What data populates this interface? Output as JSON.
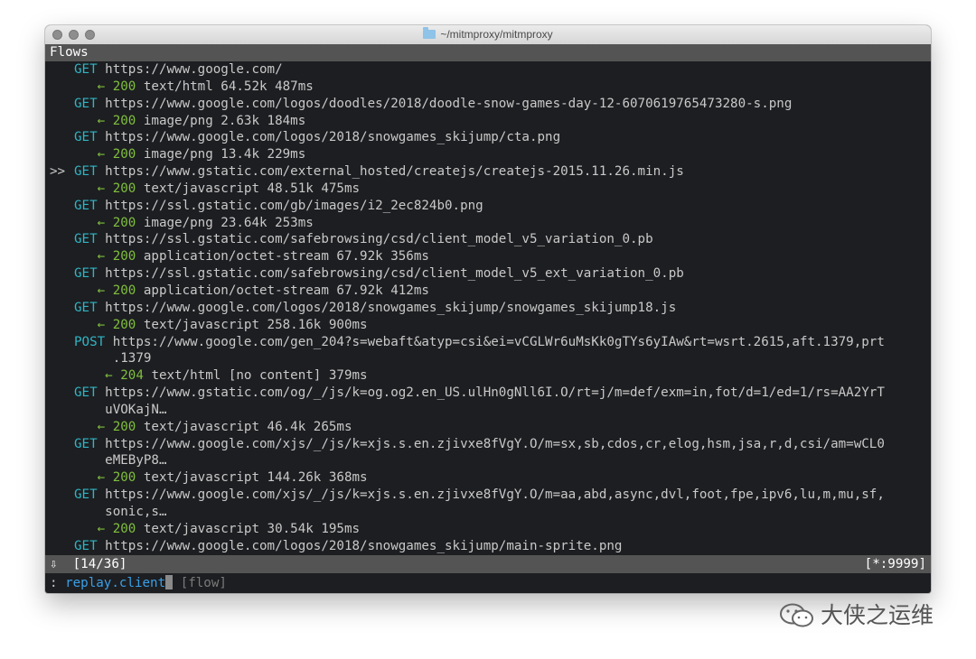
{
  "window": {
    "title": "~/mitmproxy/mitmproxy"
  },
  "header": {
    "title": "Flows"
  },
  "flows": [
    {
      "focused": false,
      "method": "GET",
      "url": "https://www.google.com/",
      "status": "200",
      "response": "text/html 64.52k 487ms"
    },
    {
      "focused": false,
      "method": "GET",
      "url": "https://www.google.com/logos/doodles/2018/doodle-snow-games-day-12-6070619765473280-s.png",
      "status": "200",
      "response": "image/png 2.63k 184ms"
    },
    {
      "focused": false,
      "method": "GET",
      "url": "https://www.google.com/logos/2018/snowgames_skijump/cta.png",
      "status": "200",
      "response": "image/png 13.4k 229ms"
    },
    {
      "focused": true,
      "method": "GET",
      "url": "https://www.gstatic.com/external_hosted/createjs/createjs-2015.11.26.min.js",
      "status": "200",
      "response": "text/javascript 48.51k 475ms"
    },
    {
      "focused": false,
      "method": "GET",
      "url": "https://ssl.gstatic.com/gb/images/i2_2ec824b0.png",
      "status": "200",
      "response": "image/png 23.64k 253ms"
    },
    {
      "focused": false,
      "method": "GET",
      "url": "https://ssl.gstatic.com/safebrowsing/csd/client_model_v5_variation_0.pb",
      "status": "200",
      "response": "application/octet-stream 67.92k 356ms"
    },
    {
      "focused": false,
      "method": "GET",
      "url": "https://ssl.gstatic.com/safebrowsing/csd/client_model_v5_ext_variation_0.pb",
      "status": "200",
      "response": "application/octet-stream 67.92k 412ms"
    },
    {
      "focused": false,
      "method": "GET",
      "url": "https://www.google.com/logos/2018/snowgames_skijump/snowgames_skijump18.js",
      "status": "200",
      "response": "text/javascript 258.16k 900ms"
    },
    {
      "focused": false,
      "method": "POST",
      "url": "https://www.google.com/gen_204?s=webaft&atyp=csi&ei=vCGLWr6uMsKk0gTYs6yIAw&rt=wsrt.2615,aft.1379,prt",
      "url2": ".1379",
      "status": "204",
      "response": "text/html [no content] 379ms"
    },
    {
      "focused": false,
      "method": "GET",
      "url": "https://www.gstatic.com/og/_/js/k=og.og2.en_US.ulHn0gNll6I.O/rt=j/m=def/exm=in,fot/d=1/ed=1/rs=AA2YrT",
      "url2": "uVOKajN…",
      "status": "200",
      "response": "text/javascript 46.4k 265ms"
    },
    {
      "focused": false,
      "method": "GET",
      "url": "https://www.google.com/xjs/_/js/k=xjs.s.en.zjivxe8fVgY.O/m=sx,sb,cdos,cr,elog,hsm,jsa,r,d,csi/am=wCL0",
      "url2": "eMEByP8…",
      "status": "200",
      "response": "text/javascript 144.26k 368ms"
    },
    {
      "focused": false,
      "method": "GET",
      "url": "https://www.google.com/xjs/_/js/k=xjs.s.en.zjivxe8fVgY.O/m=aa,abd,async,dvl,foot,fpe,ipv6,lu,m,mu,sf,",
      "url2": "sonic,s…",
      "status": "200",
      "response": "text/javascript 30.54k 195ms"
    },
    {
      "focused": false,
      "method": "GET",
      "url": "https://www.google.com/logos/2018/snowgames_skijump/main-sprite.png"
    }
  ],
  "statusbar": {
    "position": "[14/36]",
    "listen": "[*:9999]",
    "scroll_icon": "down-arrow-icon"
  },
  "command": {
    "prompt": ":",
    "text": "replay.client",
    "hint": "[flow]"
  },
  "watermark": {
    "text": "大侠之运维",
    "icon": "wechat-icon"
  },
  "colors": {
    "method": "#2fb6c6",
    "status": "#7fbf3f",
    "command": "#3aa0e8",
    "bar": "#545454",
    "background": "#1d1e21"
  }
}
